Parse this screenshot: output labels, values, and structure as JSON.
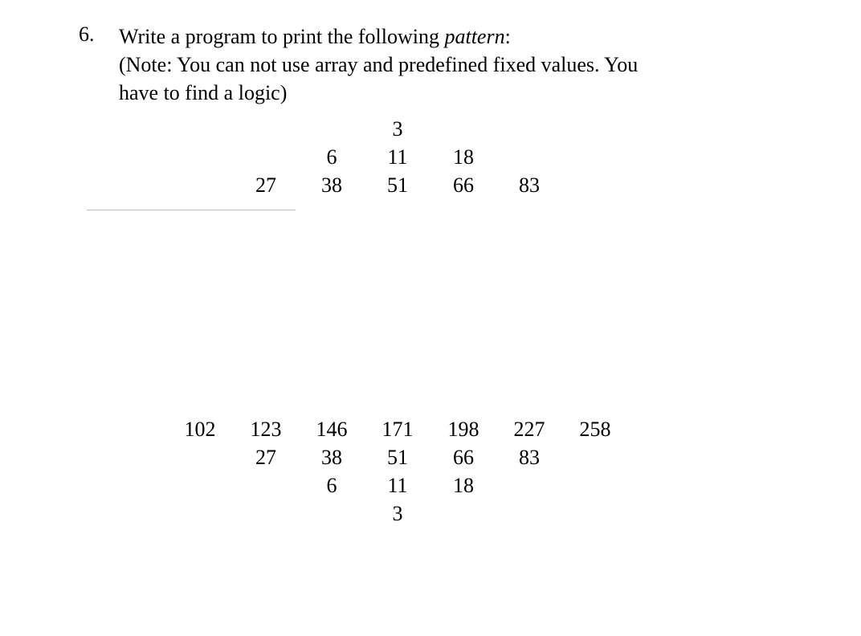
{
  "question": {
    "number": "6.",
    "line1_a": "Write a program to print the following ",
    "line1_b": "pattern",
    "line1_c": ":",
    "line2": "(Note: You can not use array and predefined fixed values. You",
    "line3": "have to find a logic)"
  },
  "pattern": {
    "top": [
      [
        "",
        "",
        "",
        "3",
        "",
        "",
        ""
      ],
      [
        "",
        "",
        "6",
        "11",
        "18",
        "",
        ""
      ],
      [
        "",
        "27",
        "38",
        "51",
        "66",
        "83",
        ""
      ]
    ],
    "bottom": [
      [
        "102",
        "123",
        "146",
        "171",
        "198",
        "227",
        "258"
      ],
      [
        "",
        "27",
        "38",
        "51",
        "66",
        "83",
        ""
      ],
      [
        "",
        "",
        "6",
        "11",
        "18",
        "",
        ""
      ],
      [
        "",
        "",
        "",
        "3",
        "",
        "",
        ""
      ]
    ]
  }
}
